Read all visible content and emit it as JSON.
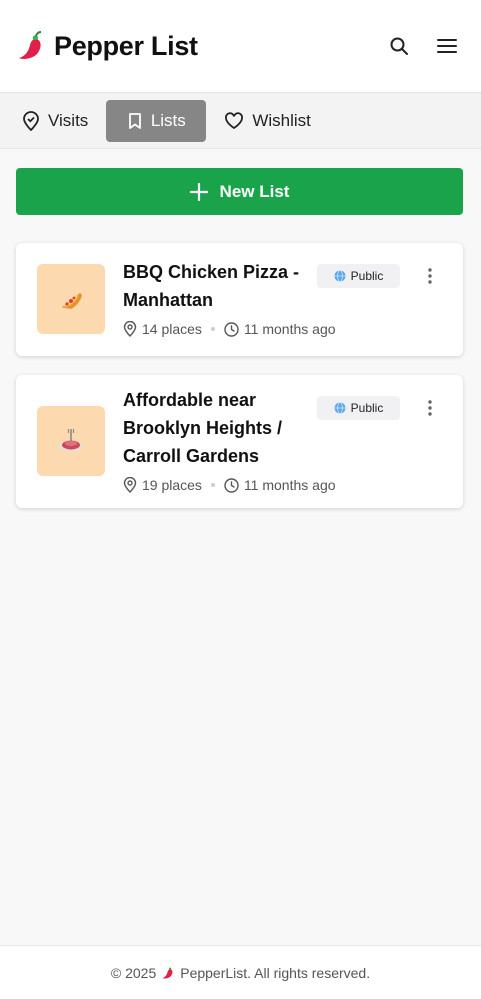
{
  "app": {
    "title": "Pepper List"
  },
  "tabs": [
    {
      "label": "Visits",
      "icon": "location-check-icon",
      "active": false
    },
    {
      "label": "Lists",
      "icon": "bookmark-icon",
      "active": true
    },
    {
      "label": "Wishlist",
      "icon": "heart-icon",
      "active": false
    }
  ],
  "new_list": {
    "label": "New List"
  },
  "lists": [
    {
      "title": "BBQ Chicken Pizza - Manhattan",
      "visibility": "Public",
      "places": "14 places",
      "updated": "11 months ago",
      "icon": "pizza-icon"
    },
    {
      "title": "Affordable near Brooklyn Heights / Carroll Gardens",
      "visibility": "Public",
      "places": "19 places",
      "updated": "11 months ago",
      "icon": "spaghetti-icon"
    }
  ],
  "footer": {
    "prefix": "© 2025",
    "brand": "PepperList. All rights reserved."
  },
  "colors": {
    "primary": "#1aa34a",
    "active_tab": "#868686",
    "thumb_bg": "#fdd9b0"
  }
}
